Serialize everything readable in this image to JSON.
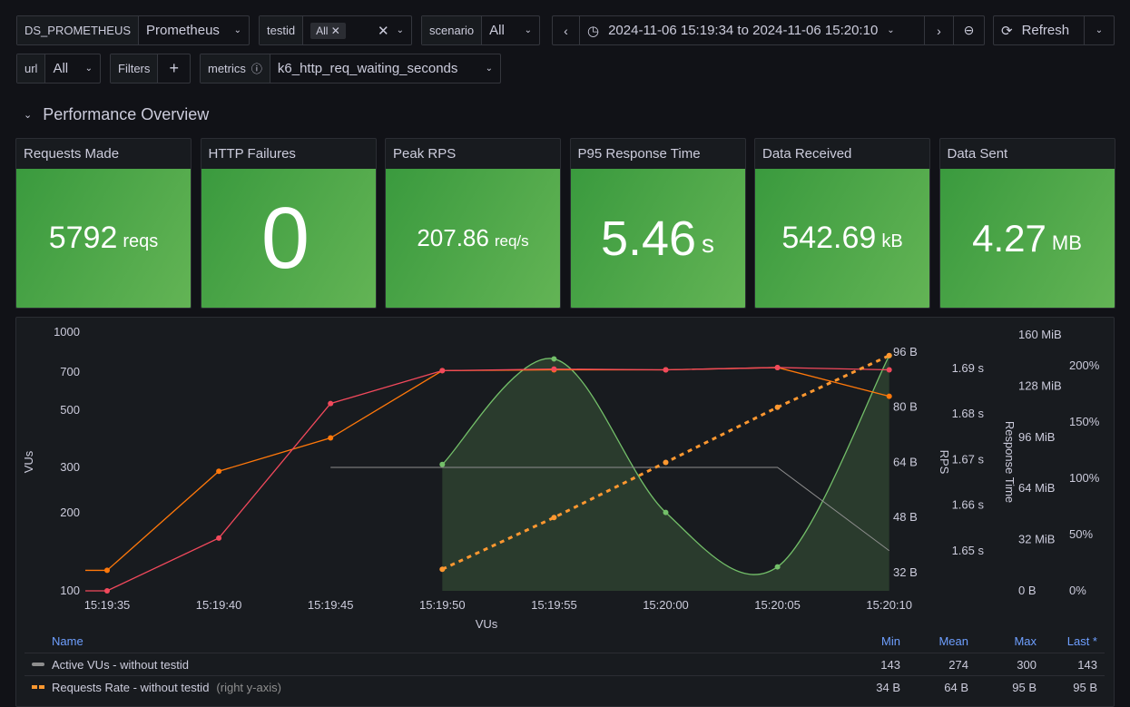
{
  "vars": {
    "datasource": {
      "label": "DS_PROMETHEUS",
      "value": "Prometheus"
    },
    "testid": {
      "label": "testid",
      "value": "All"
    },
    "scenario": {
      "label": "scenario",
      "value": "All"
    },
    "url": {
      "label": "url",
      "value": "All"
    },
    "filters": {
      "label": "Filters"
    },
    "metrics": {
      "label": "metrics",
      "value": "k6_http_req_waiting_seconds"
    }
  },
  "time": {
    "range": "2024-11-06 15:19:34 to 2024-11-06 15:20:10",
    "refresh": "Refresh"
  },
  "section": {
    "title": "Performance Overview"
  },
  "stats": [
    {
      "title": "Requests Made",
      "value": "5792",
      "unit": "reqs"
    },
    {
      "title": "HTTP Failures",
      "value": "0",
      "unit": ""
    },
    {
      "title": "Peak RPS",
      "value": "207.86",
      "unit": "req/s"
    },
    {
      "title": "P95 Response Time",
      "value": "5.46",
      "unit": "s"
    },
    {
      "title": "Data Received",
      "value": "542.69",
      "unit": "kB"
    },
    {
      "title": "Data Sent",
      "value": "4.27",
      "unit": "MB"
    }
  ],
  "chart_data": {
    "type": "line",
    "xlabel": "VUs",
    "x": [
      "15:19:35",
      "15:19:40",
      "15:19:45",
      "15:19:50",
      "15:19:55",
      "15:20:00",
      "15:20:05",
      "15:20:10"
    ],
    "axes": {
      "left": {
        "label": "VUs",
        "scale": "log",
        "ticks": [
          "1000",
          "700",
          "500",
          "300",
          "200",
          "100"
        ],
        "range": [
          100,
          1000
        ]
      },
      "bytes": {
        "ticks": [
          "96 B",
          "80 B",
          "64 B",
          "48 B",
          "32 B"
        ],
        "range": [
          32,
          96
        ]
      },
      "rps": {
        "label": "RPS",
        "ticks": [
          "1.69 s",
          "1.68 s",
          "1.67 s",
          "1.66 s",
          "1.65 s"
        ]
      },
      "mib": {
        "label": "Response Time",
        "ticks": [
          "160 MiB",
          "128 MiB",
          "96 MiB",
          "64 MiB",
          "32 MiB",
          "0 B"
        ],
        "range": [
          0,
          160
        ]
      },
      "pct": {
        "ticks": [
          "200%",
          "150%",
          "100%",
          "50%",
          "0%"
        ]
      }
    },
    "series": [
      {
        "color": "#f2495c",
        "axis": "left",
        "values": [
          100,
          160,
          530,
          710,
          720,
          715,
          730,
          715
        ]
      },
      {
        "color": "#ff780a",
        "axis": "left",
        "values": [
          120,
          290,
          390,
          710,
          715,
          715,
          730,
          565
        ]
      },
      {
        "name": "Active VUs - without testid",
        "color": "#8e8e8e",
        "axis": "left",
        "values": [
          null,
          null,
          300,
          300,
          300,
          300,
          300,
          143
        ]
      },
      {
        "name": "Requests Rate - without testid",
        "color": "#ff9830",
        "axis": "bytes",
        "dashed": true,
        "values": [
          null,
          null,
          null,
          33,
          48,
          64,
          80,
          95
        ]
      },
      {
        "color": "#73bf69",
        "axis": "mib",
        "fill": true,
        "values": [
          null,
          null,
          null,
          79,
          145,
          49,
          15,
          147
        ]
      }
    ],
    "legend": {
      "headers": [
        "Name",
        "Min",
        "Mean",
        "Max",
        "Last *"
      ],
      "rows": [
        {
          "name": "Active VUs - without testid",
          "suffix": "",
          "min": "143",
          "mean": "274",
          "max": "300",
          "last": "143"
        },
        {
          "name": "Requests Rate - without testid",
          "suffix": "(right y-axis)",
          "min": "34 B",
          "mean": "64 B",
          "max": "95 B",
          "last": "95 B"
        }
      ]
    }
  }
}
